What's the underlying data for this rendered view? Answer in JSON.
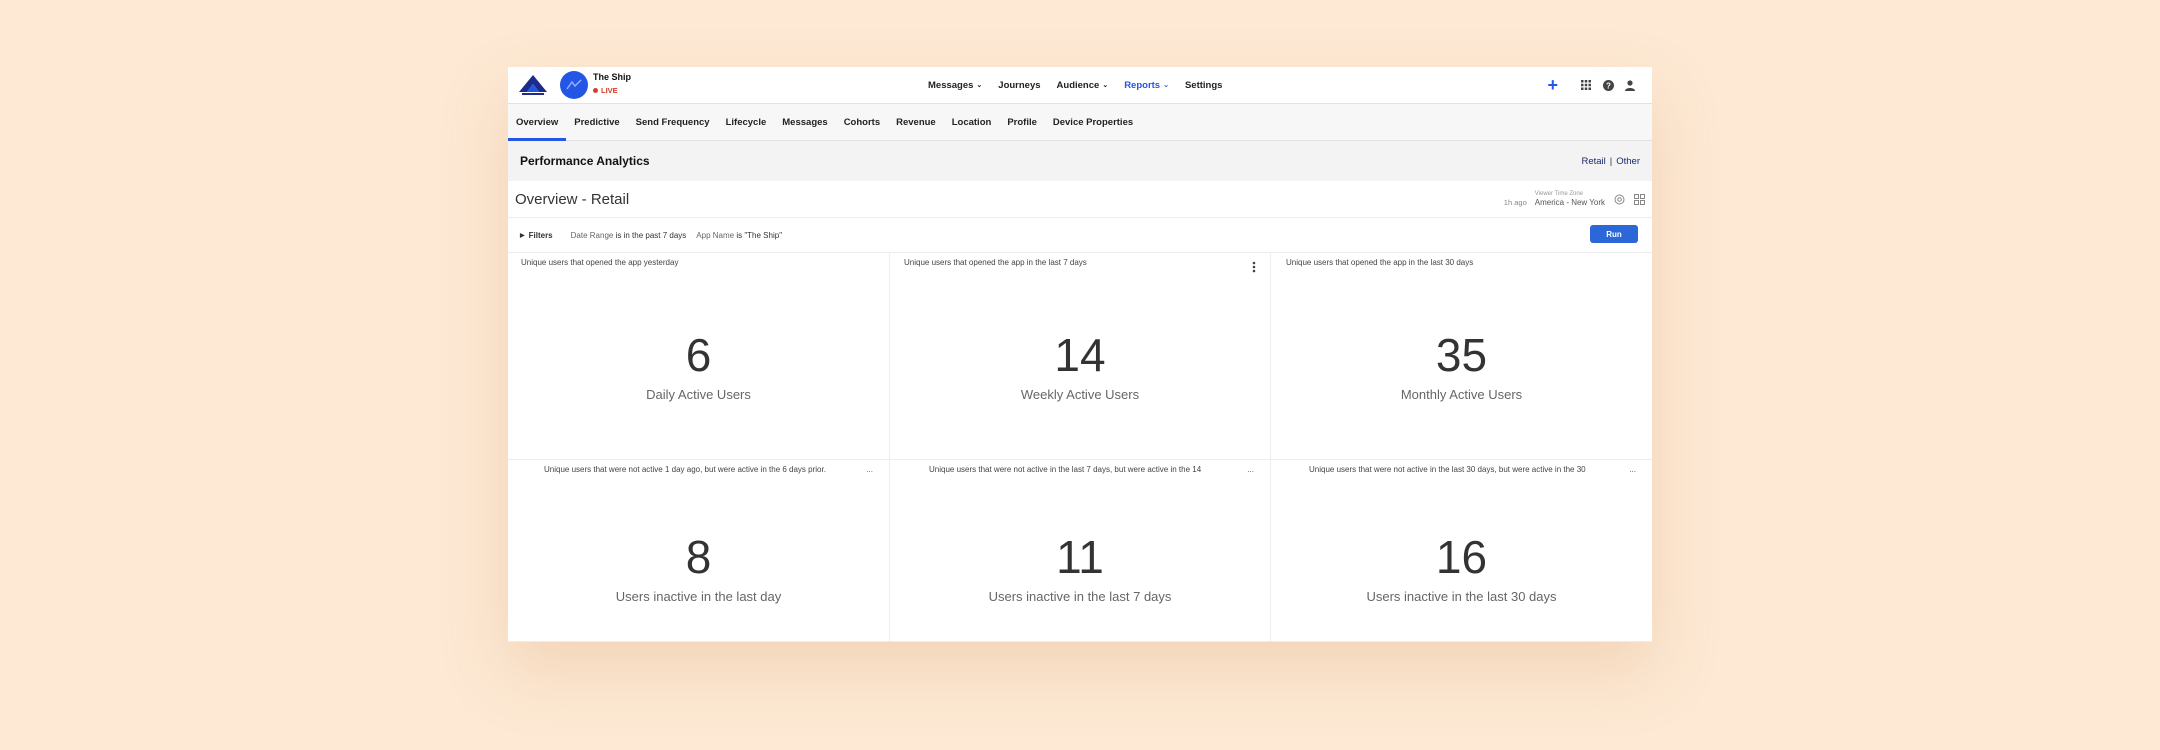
{
  "app": {
    "name": "The Ship",
    "status": "LIVE",
    "brand_color": "#2456e5",
    "status_color": "#d0402b"
  },
  "nav": {
    "items": [
      {
        "label": "Messages",
        "dropdown": true,
        "active": false
      },
      {
        "label": "Journeys",
        "dropdown": false,
        "active": false
      },
      {
        "label": "Audience",
        "dropdown": true,
        "active": false
      },
      {
        "label": "Reports",
        "dropdown": true,
        "active": true
      },
      {
        "label": "Settings",
        "dropdown": false,
        "active": false
      }
    ],
    "icons": [
      "plus-icon",
      "grid-icon",
      "help-icon",
      "user-icon"
    ]
  },
  "subtabs": [
    "Overview",
    "Predictive",
    "Send Frequency",
    "Lifecycle",
    "Messages",
    "Cohorts",
    "Revenue",
    "Location",
    "Profile",
    "Device Properties"
  ],
  "page": {
    "title": "Performance Analytics",
    "view_retail": "Retail",
    "view_sep": "|",
    "view_other": "Other"
  },
  "dashboard": {
    "title": "Overview - Retail",
    "last_run": "1h ago",
    "timezone_label": "Viewer Time Zone",
    "timezone_value": "America - New York",
    "filters_label": "Filters",
    "filter1_key": "Date Range",
    "filter1_value": "is in the past 7 days",
    "filter2_key": "App Name",
    "filter2_value": "is \"The Ship\"",
    "run_label": "Run"
  },
  "tiles": [
    {
      "description": "Unique users that opened the app yesterday",
      "value": "6",
      "label": "Daily Active Users"
    },
    {
      "description": "Unique users that opened the app in the last 7 days",
      "value": "14",
      "label": "Weekly Active Users"
    },
    {
      "description": "Unique users that opened the app in the last 30 days",
      "value": "35",
      "label": "Monthly Active Users"
    },
    {
      "description": "Unique users that were not active 1 day ago, but were active in the 6 days prior.",
      "value": "8",
      "label": "Users inactive in the last day"
    },
    {
      "description": "Unique users that were not active in the last 7 days, but were active in the 14",
      "value": "11",
      "label": "Users inactive in the last 7 days"
    },
    {
      "description": "Unique users that were not active in the last 30 days, but were active in the 30",
      "value": "16",
      "label": "Users inactive in the last 30 days"
    }
  ],
  "ellipsis": "..."
}
